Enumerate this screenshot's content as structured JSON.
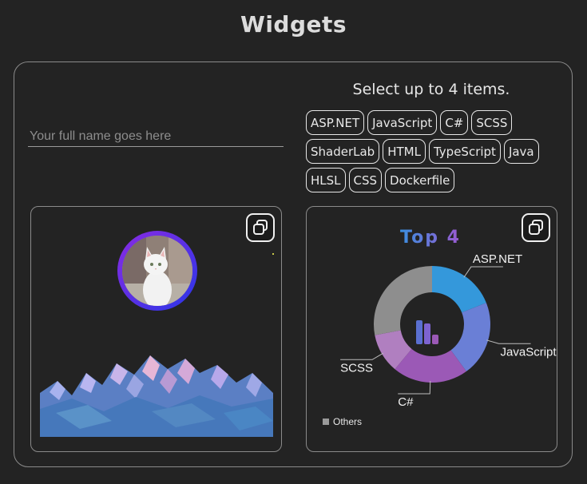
{
  "page": {
    "title": "Widgets"
  },
  "name_input": {
    "placeholder": "Your full name goes here",
    "value": ""
  },
  "selector": {
    "hint": "Select up to 4 items.",
    "items": [
      "ASP.NET",
      "JavaScript",
      "C#",
      "SCSS",
      "ShaderLab",
      "HTML",
      "TypeScript",
      "Java",
      "HLSL",
      "CSS",
      "Dockerfile"
    ]
  },
  "profile_card": {
    "copy_icon": "copy-icon",
    "avatar": "cat-photo",
    "illustration": "low-poly-mountains"
  },
  "chart_card": {
    "copy_icon": "copy-icon",
    "center_icon": "bar-chart-icon"
  },
  "chart_data": {
    "type": "pie",
    "style": "donut",
    "title": "Top 4",
    "title_colors": [
      "#3b8fe0",
      "#9b59d0"
    ],
    "categories": [
      "ASP.NET",
      "JavaScript",
      "C#",
      "SCSS",
      "Others"
    ],
    "values": [
      19,
      21,
      21,
      11,
      28
    ],
    "colors": [
      "#3498db",
      "#6a7fd6",
      "#9b59b6",
      "#b07fc0",
      "#8e8e8e"
    ],
    "legend": {
      "position": "bottom-left",
      "entries": [
        "Others"
      ]
    }
  }
}
